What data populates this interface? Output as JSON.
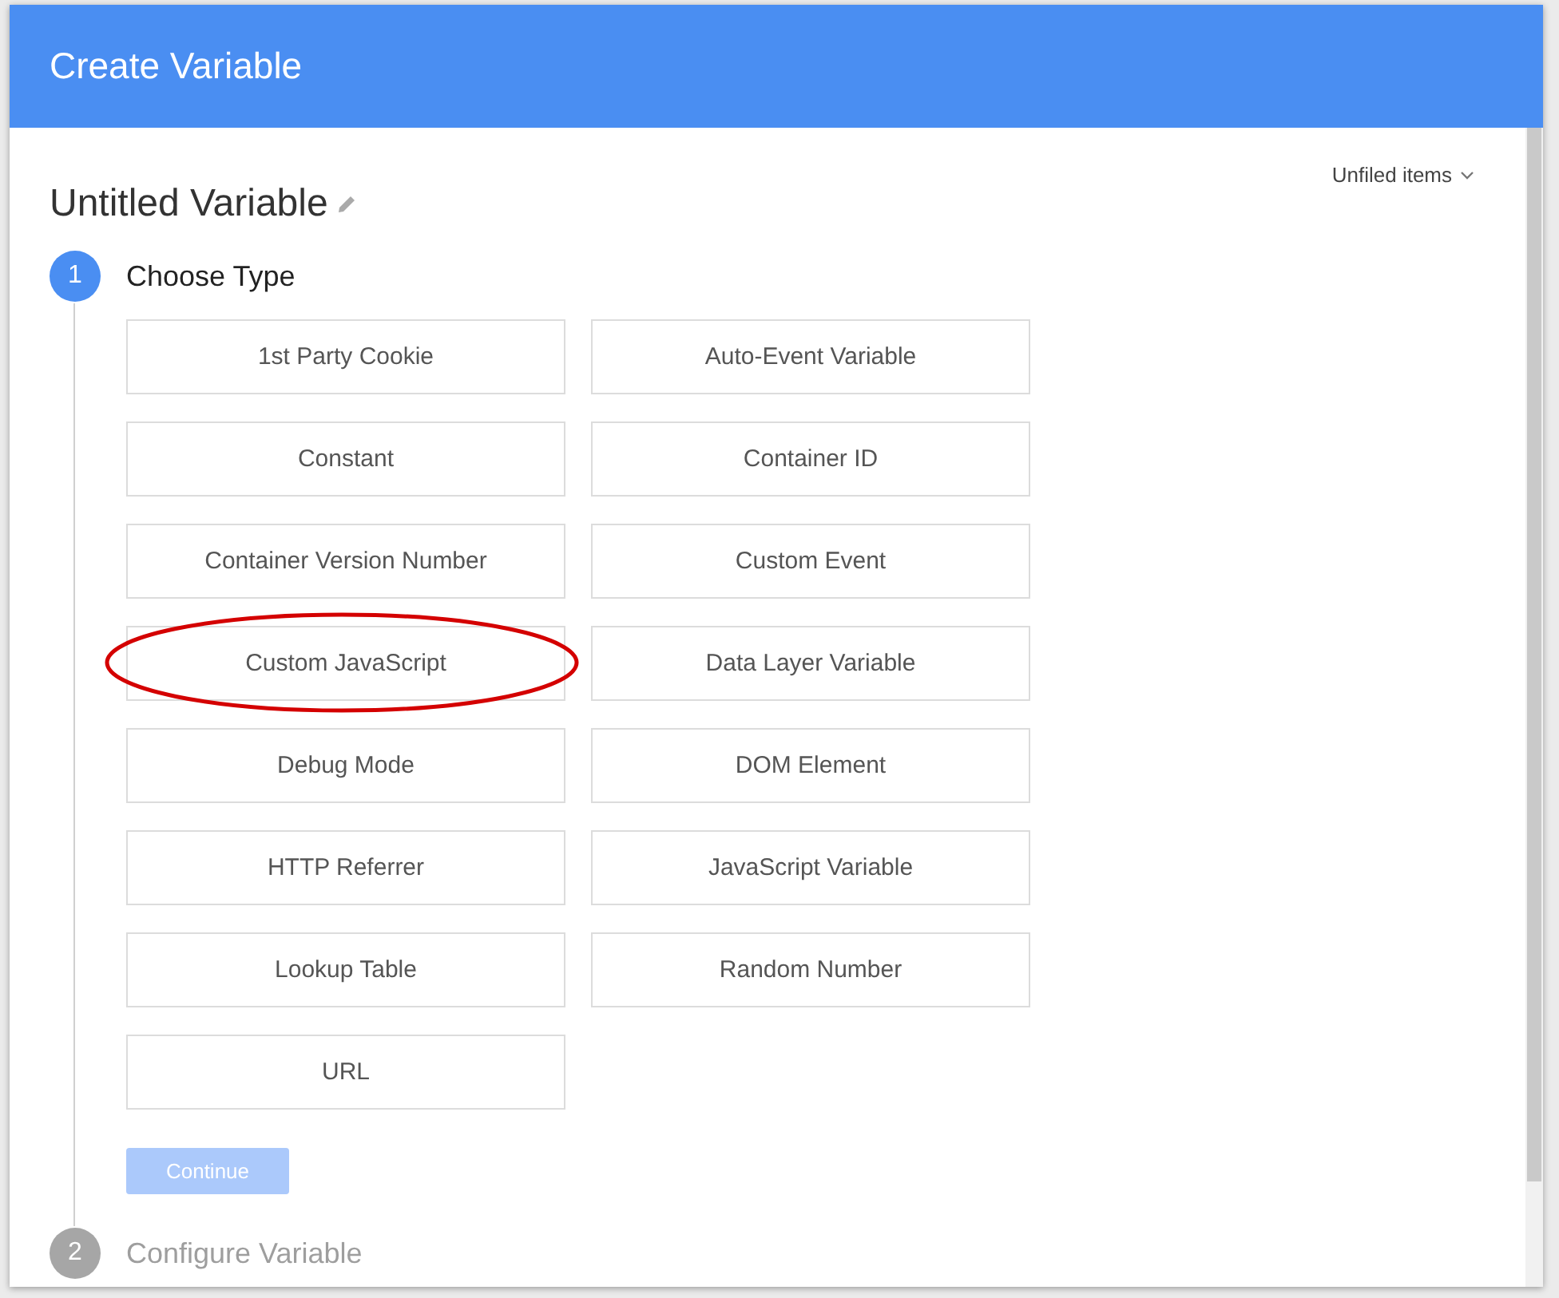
{
  "dialog": {
    "title": "Create Variable"
  },
  "variable": {
    "name": "Untitled Variable"
  },
  "folder": {
    "label": "Unfiled items"
  },
  "steps": [
    {
      "number": "1",
      "label": "Choose Type",
      "active": true
    },
    {
      "number": "2",
      "label": "Configure Variable",
      "active": false
    }
  ],
  "types": [
    {
      "label": "1st Party Cookie",
      "circled": false
    },
    {
      "label": "Auto-Event Variable",
      "circled": false
    },
    {
      "label": "Constant",
      "circled": false
    },
    {
      "label": "Container ID",
      "circled": false
    },
    {
      "label": "Container Version Number",
      "circled": false
    },
    {
      "label": "Custom Event",
      "circled": false
    },
    {
      "label": "Custom JavaScript",
      "circled": true
    },
    {
      "label": "Data Layer Variable",
      "circled": false
    },
    {
      "label": "Debug Mode",
      "circled": false
    },
    {
      "label": "DOM Element",
      "circled": false
    },
    {
      "label": "HTTP Referrer",
      "circled": false
    },
    {
      "label": "JavaScript Variable",
      "circled": false
    },
    {
      "label": "Lookup Table",
      "circled": false
    },
    {
      "label": "Random Number",
      "circled": false
    },
    {
      "label": "URL",
      "circled": false
    }
  ],
  "continue_button": {
    "label": "Continue",
    "disabled": true
  }
}
